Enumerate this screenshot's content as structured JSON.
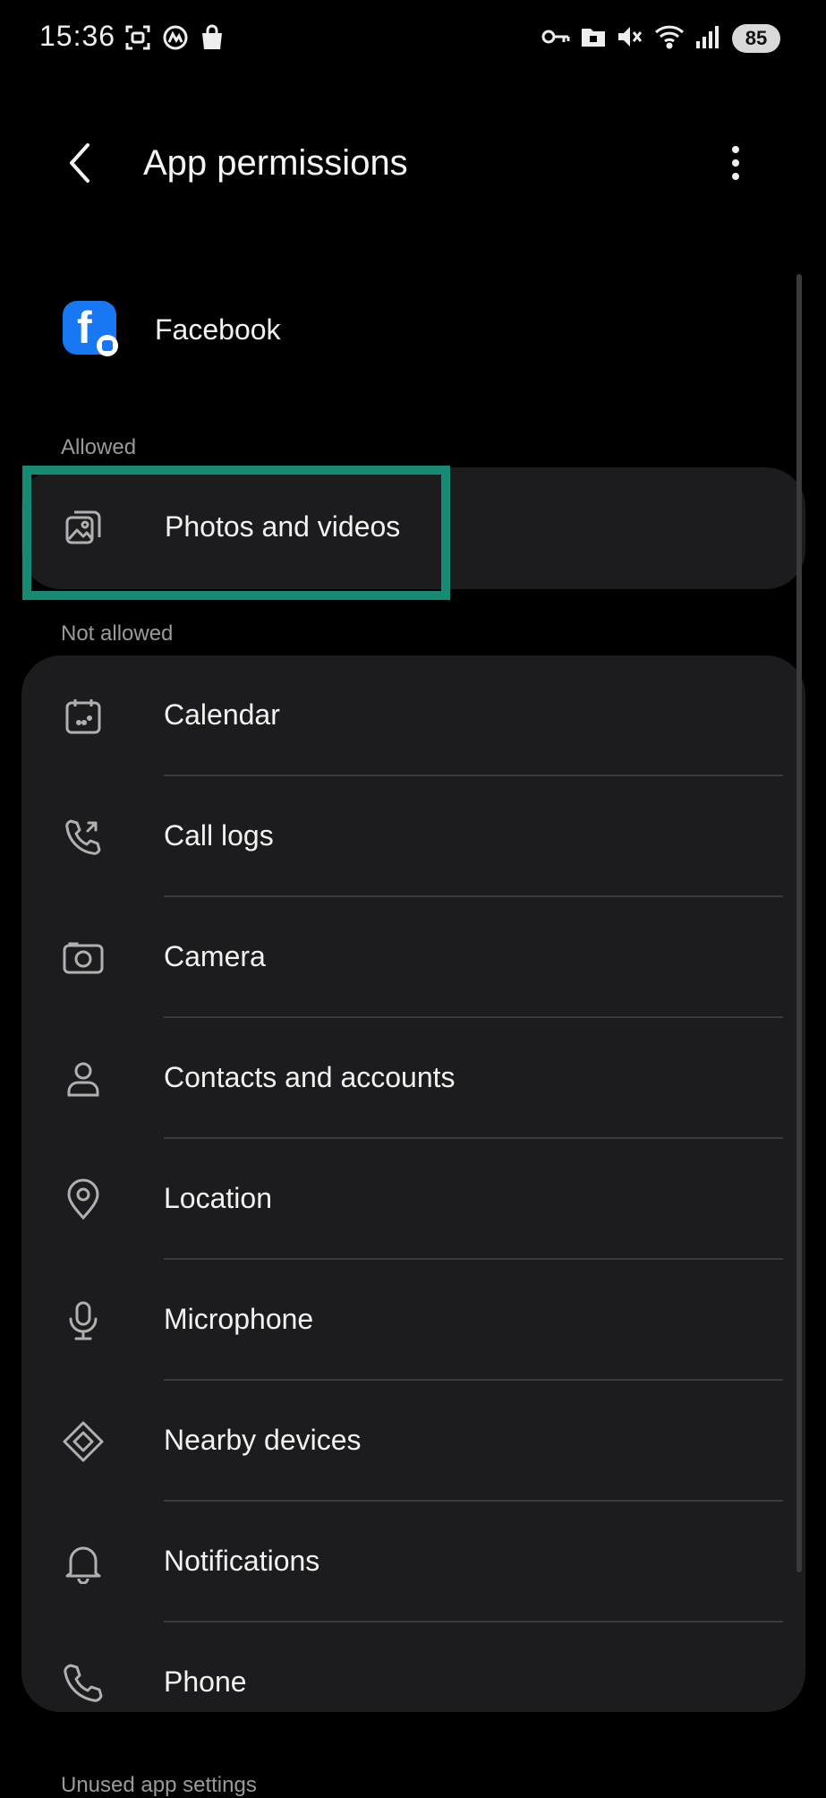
{
  "status_bar": {
    "time": "15:36",
    "battery": "85",
    "left_icons": [
      "screen-recorder-icon",
      "mobile-app-icon",
      "shopping-bag-icon"
    ],
    "right_icons": [
      "key-icon",
      "folder-lock-icon",
      "mute-icon",
      "wifi-icon",
      "signal-icon"
    ]
  },
  "app_bar": {
    "title": "App permissions",
    "back_icon": "chevron-left-icon",
    "more_icon": "more-vertical-icon"
  },
  "app": {
    "name": "Facebook",
    "icon": "facebook-icon",
    "brand_color": "#1877f2"
  },
  "sections": {
    "allowed_label": "Allowed",
    "not_allowed_label": "Not allowed",
    "unused_label": "Unused app settings"
  },
  "allowed": [
    {
      "label": "Photos and videos",
      "icon": "photos-icon"
    }
  ],
  "not_allowed": [
    {
      "label": "Calendar",
      "icon": "calendar-icon"
    },
    {
      "label": "Call logs",
      "icon": "call-log-icon"
    },
    {
      "label": "Camera",
      "icon": "camera-icon"
    },
    {
      "label": "Contacts and accounts",
      "icon": "person-icon"
    },
    {
      "label": "Location",
      "icon": "location-pin-icon"
    },
    {
      "label": "Microphone",
      "icon": "microphone-icon"
    },
    {
      "label": "Nearby devices",
      "icon": "nearby-devices-icon"
    },
    {
      "label": "Notifications",
      "icon": "bell-icon"
    },
    {
      "label": "Phone",
      "icon": "phone-icon"
    }
  ],
  "colors": {
    "background": "#000000",
    "card": "#1c1c1e",
    "highlight": "#168a73",
    "secondary_text": "#9a9a9a"
  }
}
